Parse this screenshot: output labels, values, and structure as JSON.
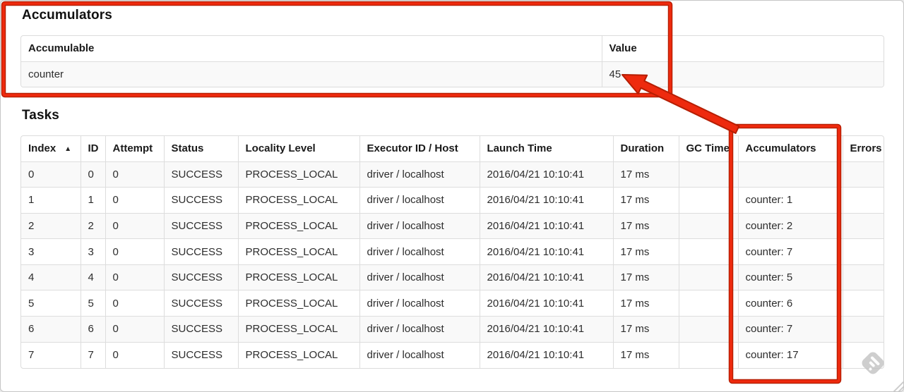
{
  "accumulators_section": {
    "title": "Accumulators",
    "table": {
      "headers": [
        "Accumulable",
        "Value"
      ],
      "rows": [
        [
          "counter",
          "45"
        ]
      ]
    }
  },
  "tasks_section": {
    "title": "Tasks",
    "table": {
      "headers": [
        "Index",
        "ID",
        "Attempt",
        "Status",
        "Locality Level",
        "Executor ID / Host",
        "Launch Time",
        "Duration",
        "GC Time",
        "Accumulators",
        "Errors"
      ],
      "sort": {
        "column": "Index",
        "direction": "asc",
        "icon": "▲"
      },
      "rows": [
        [
          "0",
          "0",
          "0",
          "SUCCESS",
          "PROCESS_LOCAL",
          "driver / localhost",
          "2016/04/21 10:10:41",
          "17 ms",
          "",
          "",
          ""
        ],
        [
          "1",
          "1",
          "0",
          "SUCCESS",
          "PROCESS_LOCAL",
          "driver / localhost",
          "2016/04/21 10:10:41",
          "17 ms",
          "",
          "counter: 1",
          ""
        ],
        [
          "2",
          "2",
          "0",
          "SUCCESS",
          "PROCESS_LOCAL",
          "driver / localhost",
          "2016/04/21 10:10:41",
          "17 ms",
          "",
          "counter: 2",
          ""
        ],
        [
          "3",
          "3",
          "0",
          "SUCCESS",
          "PROCESS_LOCAL",
          "driver / localhost",
          "2016/04/21 10:10:41",
          "17 ms",
          "",
          "counter: 7",
          ""
        ],
        [
          "4",
          "4",
          "0",
          "SUCCESS",
          "PROCESS_LOCAL",
          "driver / localhost",
          "2016/04/21 10:10:41",
          "17 ms",
          "",
          "counter: 5",
          ""
        ],
        [
          "5",
          "5",
          "0",
          "SUCCESS",
          "PROCESS_LOCAL",
          "driver / localhost",
          "2016/04/21 10:10:41",
          "17 ms",
          "",
          "counter: 6",
          ""
        ],
        [
          "6",
          "6",
          "0",
          "SUCCESS",
          "PROCESS_LOCAL",
          "driver / localhost",
          "2016/04/21 10:10:41",
          "17 ms",
          "",
          "counter: 7",
          ""
        ],
        [
          "7",
          "7",
          "0",
          "SUCCESS",
          "PROCESS_LOCAL",
          "driver / localhost",
          "2016/04/21 10:10:41",
          "17 ms",
          "",
          "counter: 17",
          ""
        ]
      ]
    }
  },
  "annotations": {
    "color": "#ee2a0e",
    "edge_color": "#b51e03",
    "watermark_color": "#c2c2c2"
  }
}
